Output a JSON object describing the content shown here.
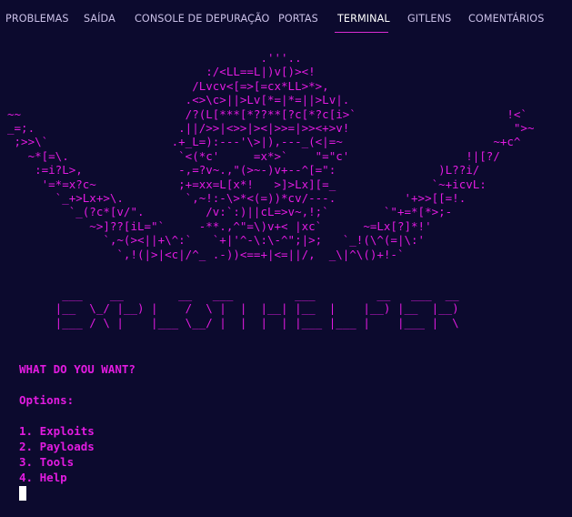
{
  "panel_tabs": [
    {
      "label": "PROBLEMAS"
    },
    {
      "label": "SAÍDA"
    },
    {
      "label": "CONSOLE DE DEPURAÇÃO"
    },
    {
      "label": "PORTAS"
    },
    {
      "label": "TERMINAL",
      "active": true
    },
    {
      "label": "GITLENS"
    },
    {
      "label": "COMENTÁRIOS"
    }
  ],
  "terminal": {
    "ascii_art": "                                     .'''..\n                             :/<LL==L|)v[)><!\n                           /Lvcv<[=>[=cx*LL>*>,\n                          .<>\\c>||>Lv[*=|*=||>Lv|.\n~~                        /?(L[***[*??**[?c[*?c[i>`                      !<`\n_=;.                     .||/>>|<>>|><|>>=|>><+>v!                        \">~\n ;>>\\`                  .+_L=):---'\\>|),---_(<|=~                      ~+c^\n   ~*[=\\.                `<(*c'     =x*>`    \"=\"c'                 !|[?/\n    :=i?L>,              -,=?v~.,\"(>~-)v+--^[=\":               )L??i/\n     '=*=x?c~            ;+=xx=L[x*!   >]>Lx][=_              `~+icvL:\n       `_+>Lx+>\\.         `,~!:-\\>*<(=))*cv/---.          '+>>[[=!.\n         `_(?c*[v/\".         /v:`:)||cL=>v~,!;`        `\"+=*[*>;-\n            ~>]??[iL=\"`     -**.,^\"=\\)v+< |xc`      ~=Lx[?]*!'\n              `,~(><||+\\^:`   `+|'^-\\:\\-^\";|>;   `_!(\\^(=|\\:'\n                `,!(|>|<c|/^_ .-))<==+|<=||/,  _\\|^\\()+!-`",
    "logo": "        ___    __        __   ___         ___         __   ___  __\n       |__  \\_/ |__) |    /  \\ |  |  |__| |__  |    |__) |__  |__)\n       |___ / \\ |    |___ \\__/ |  |  |  | |___ |___ |    |___ |  \\",
    "prompt": "WHAT DO YOU WANT?",
    "options_label": "Options:",
    "options": [
      "1. Exploits",
      "2. Payloads",
      "3. Tools",
      "4. Help"
    ]
  },
  "colors": {
    "background": "#0c0a2e",
    "terminal_text": "#e21be0",
    "tab_text": "#c9bfe6",
    "active_tab_underline": "#d92bd0",
    "cursor": "#ffffff"
  }
}
